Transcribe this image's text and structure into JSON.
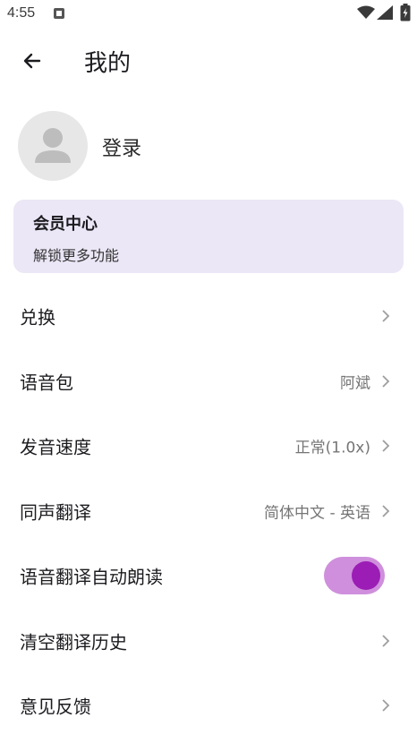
{
  "status_bar": {
    "time": "4:55",
    "notification_icon": "a-square-icon",
    "wifi_icon": "wifi-icon",
    "signal_icon": "cell-signal-icon",
    "battery_icon": "battery-charging-icon"
  },
  "header": {
    "back_icon": "arrow-left-icon",
    "title": "我的"
  },
  "profile": {
    "avatar_icon": "person-icon",
    "login_label": "登录"
  },
  "vip": {
    "title": "会员中心",
    "subtitle": "解锁更多功能",
    "background_color": "#ebe7f6"
  },
  "menu": {
    "redeem": {
      "label": "兑换"
    },
    "voice_pack": {
      "label": "语音包",
      "value": "阿斌"
    },
    "speech_speed": {
      "label": "发音速度",
      "value": "正常(1.0x)"
    },
    "simultaneous": {
      "label": "同声翻译",
      "value": "简体中文 - 英语"
    },
    "auto_read": {
      "label": "语音翻译自动朗读",
      "toggle_on": true,
      "toggle_color": "#9b1db5"
    },
    "clear_history": {
      "label": "清空翻译历史"
    },
    "feedback": {
      "label": "意见反馈"
    }
  }
}
